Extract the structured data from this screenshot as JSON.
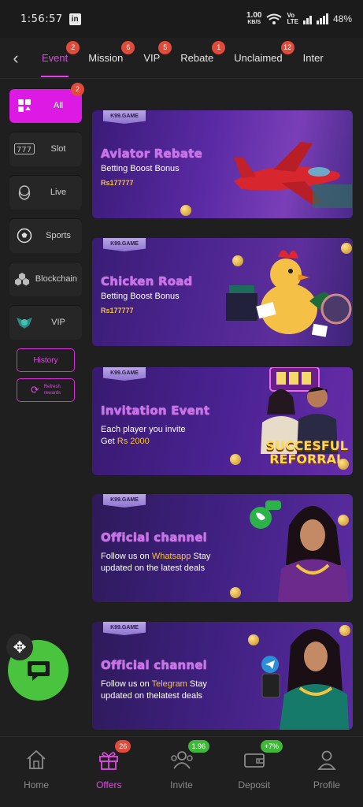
{
  "status": {
    "time": "1:56:57",
    "app_icon": "in",
    "speed": "1.00",
    "speed_unit": "KB/S",
    "lte_top": "Vo",
    "lte_bottom": "LTE",
    "battery": "48%"
  },
  "tabs": [
    {
      "label": "Event",
      "badge": "2",
      "active": true
    },
    {
      "label": "Mission",
      "badge": "6"
    },
    {
      "label": "VIP",
      "badge": "5"
    },
    {
      "label": "Rebate",
      "badge": "1"
    },
    {
      "label": "Unclaimed",
      "badge": "12"
    },
    {
      "label": "Inter"
    }
  ],
  "sidebar": {
    "items": [
      {
        "label": "All",
        "icon": "grid-icon",
        "badge": "2",
        "active": true
      },
      {
        "label": "Slot",
        "icon": "slot-icon"
      },
      {
        "label": "Live",
        "icon": "dealer-icon"
      },
      {
        "label": "Sports",
        "icon": "soccer-ball-icon"
      },
      {
        "label": "Blockchain",
        "icon": "blockchain-icon"
      },
      {
        "label": "VIP",
        "icon": "vip-emblem-icon"
      }
    ],
    "history_label": "History",
    "refresh_line1": "Refresh",
    "refresh_line2": "rewards"
  },
  "banners": [
    {
      "tag": "K99.GAME",
      "title": "Aviator Rebate",
      "subtitle": "Betting Boost Bonus",
      "amount": "Rs177777"
    },
    {
      "tag": "K99.GAME",
      "title": "Chicken Road",
      "subtitle": "Betting Boost Bonus",
      "amount": "Rs177777"
    },
    {
      "tag": "K99.GAME",
      "title": "Invitation Event",
      "line1": "Each player you invite",
      "line2_prefix": "Get ",
      "line2_highlight": "Rs 2000",
      "stamp_line1": "SUCCESFUL",
      "stamp_line2": "REFORRAL"
    },
    {
      "tag": "K99.GAME",
      "title": "Official channel",
      "line1_prefix": "Follow us on ",
      "line1_highlight": "Whatsapp",
      "line1_suffix": " Stay",
      "line2": "updated on the latest deals"
    },
    {
      "tag": "K99.GAME",
      "title": "Official channel",
      "line1_prefix": "Follow us on ",
      "line1_highlight": "Telegram",
      "line1_suffix": " Stay",
      "line2": "updated on thelatest deals"
    }
  ],
  "bottom_nav": [
    {
      "label": "Home",
      "icon": "home-icon"
    },
    {
      "label": "Offers",
      "icon": "gift-icon",
      "badge": "26",
      "active": true
    },
    {
      "label": "Invite",
      "icon": "invite-icon",
      "badge": "1.96"
    },
    {
      "label": "Deposit",
      "icon": "wallet-icon",
      "badge": "+7%"
    },
    {
      "label": "Profile",
      "icon": "profile-icon"
    }
  ],
  "colors": {
    "accent": "#e73ff0",
    "badge_red": "#e14b3b",
    "badge_green": "#3fb83a",
    "chat_green": "#4ac33f"
  }
}
